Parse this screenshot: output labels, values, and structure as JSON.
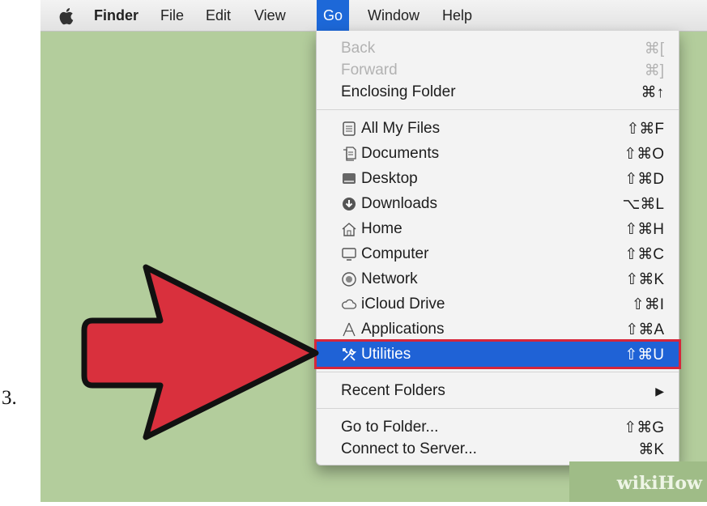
{
  "step_number": "3.",
  "menubar": {
    "items": [
      {
        "label": "Finder",
        "bold": true
      },
      {
        "label": "File"
      },
      {
        "label": "Edit"
      },
      {
        "label": "View"
      },
      {
        "label": "Go",
        "active": true
      },
      {
        "label": "Window"
      },
      {
        "label": "Help"
      }
    ]
  },
  "go_menu": {
    "group1": [
      {
        "label": "Back",
        "shortcut": "⌘[",
        "disabled": true
      },
      {
        "label": "Forward",
        "shortcut": "⌘]",
        "disabled": true
      },
      {
        "label": "Enclosing Folder",
        "shortcut": "⌘↑"
      }
    ],
    "group2": [
      {
        "label": "All My Files",
        "shortcut": "⇧⌘F",
        "icon": "all-my-files-icon"
      },
      {
        "label": "Documents",
        "shortcut": "⇧⌘O",
        "icon": "documents-icon"
      },
      {
        "label": "Desktop",
        "shortcut": "⇧⌘D",
        "icon": "desktop-icon"
      },
      {
        "label": "Downloads",
        "shortcut": "⌥⌘L",
        "icon": "downloads-icon"
      },
      {
        "label": "Home",
        "shortcut": "⇧⌘H",
        "icon": "home-icon"
      },
      {
        "label": "Computer",
        "shortcut": "⇧⌘C",
        "icon": "computer-icon"
      },
      {
        "label": "Network",
        "shortcut": "⇧⌘K",
        "icon": "network-icon"
      },
      {
        "label": "iCloud Drive",
        "shortcut": "⇧⌘I",
        "icon": "icloud-icon"
      },
      {
        "label": "Applications",
        "shortcut": "⇧⌘A",
        "icon": "applications-icon"
      },
      {
        "label": "Utilities",
        "shortcut": "⇧⌘U",
        "icon": "utilities-icon",
        "selected": true
      }
    ],
    "group3": [
      {
        "label": "Recent Folders",
        "shortcut": "▶"
      }
    ],
    "group4": [
      {
        "label": "Go to Folder...",
        "shortcut": "⇧⌘G"
      },
      {
        "label": "Connect to Server...",
        "shortcut": "⌘K"
      }
    ]
  },
  "watermark": "wikiHow",
  "colors": {
    "background": "#b3cd9c",
    "selection": "#1f62d6",
    "highlight_border": "#d6263a",
    "arrow": "#d9303d"
  }
}
